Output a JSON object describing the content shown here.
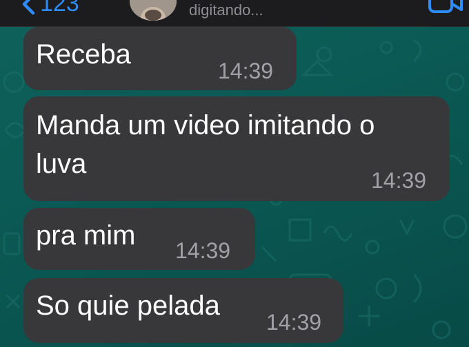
{
  "header": {
    "back_count": "123",
    "status": "digitando..."
  },
  "messages": [
    {
      "text": "Receba",
      "time": "14:39"
    },
    {
      "text_line1": "Manda um video imitando o",
      "text_line2": "luva",
      "time": "14:39"
    },
    {
      "text": "pra mim",
      "time": "14:39"
    },
    {
      "text": "So quie pelada",
      "time": "14:39"
    }
  ],
  "colors": {
    "wallpaper": "#0b5a55",
    "bubble": "#38383a",
    "accent": "#2f8cff",
    "timestamp": "#a1a1a6"
  },
  "icons": [
    "chevron-left-icon",
    "video-call-icon"
  ]
}
